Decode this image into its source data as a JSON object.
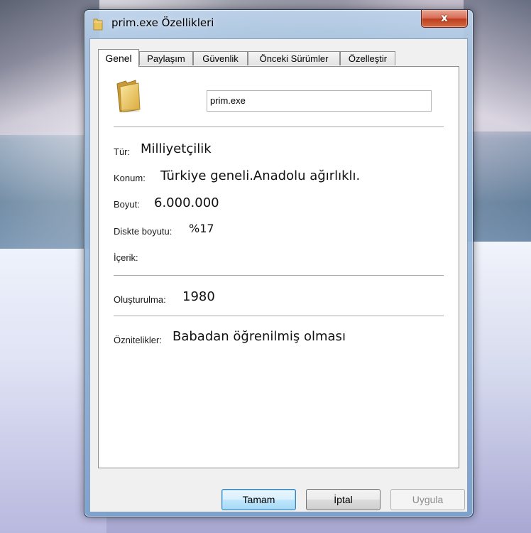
{
  "window": {
    "title": "prim.exe Özellikleri",
    "close_label": "x"
  },
  "tabs": [
    {
      "label": "Genel",
      "active": true
    },
    {
      "label": "Paylaşım"
    },
    {
      "label": "Güvenlik"
    },
    {
      "label": "Önceki Sürümler"
    },
    {
      "label": "Özelleştir"
    }
  ],
  "general": {
    "file_name": "prim.exe",
    "icon": "folder-icon",
    "fields": {
      "type_label": "Tür:",
      "type_value": "Milliyetçilik",
      "location_label": "Konum:",
      "location_value": "Türkiye geneli.Anadolu ağırlıklı.",
      "size_label": "Boyut:",
      "size_value": "6.000.000",
      "disk_size_label": "Diskte boyutu:",
      "disk_size_value": "%17",
      "contents_label": "İçerik:",
      "contents_value": "",
      "created_label": "Oluşturulma:",
      "created_value": "1980",
      "attributes_label": "Öznitelikler:",
      "attributes_value": "Babadan öğrenilmiş olması"
    }
  },
  "buttons": {
    "ok": "Tamam",
    "cancel": "İptal",
    "apply": "Uygula"
  },
  "colors": {
    "default_button": "#bee6fd",
    "close_button": "#c0401f"
  }
}
